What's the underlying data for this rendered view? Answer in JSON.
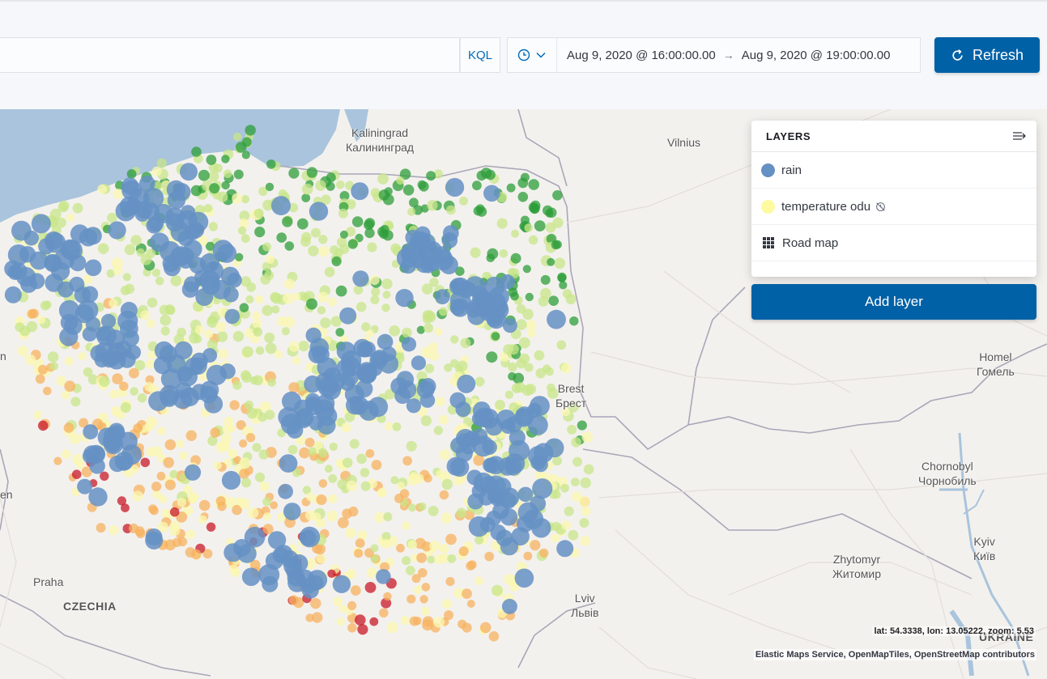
{
  "query_bar": {
    "language_toggle": "KQL",
    "date_start": "Aug 9, 2020 @ 16:00:00.00",
    "date_end": "Aug 9, 2020 @ 19:00:00.00",
    "refresh_label": "Refresh"
  },
  "map": {
    "places": [
      {
        "name": "Kaliningrad",
        "alt": "Калининград"
      },
      {
        "name": "Vilnius",
        "alt": ""
      },
      {
        "name": "Brest",
        "alt": "Брест"
      },
      {
        "name": "Homel",
        "alt": "Гомель"
      },
      {
        "name": "Chornobyl",
        "alt": "Чорнобиль"
      },
      {
        "name": "Zhytomyr",
        "alt": "Житомир"
      },
      {
        "name": "Kyiv",
        "alt": "Київ"
      },
      {
        "name": "Lviv",
        "alt": "Львів"
      },
      {
        "name": "Praha",
        "alt": ""
      }
    ],
    "countries": [
      "CZECHIA",
      "UKRAINE"
    ],
    "edge_fragments": [
      "n",
      "en"
    ],
    "colors": {
      "land": "#f3f1ee",
      "water": "#a9c4dc",
      "rain": "#6590c4",
      "temp_cool": "#2e9e3a",
      "temp_mild": "#c8e68a",
      "temp_neutral": "#fbf7b0",
      "temp_warm": "#f7b25f",
      "temp_hot": "#c8192a"
    }
  },
  "layers_panel": {
    "title": "LAYERS",
    "collapse_icon": "collapse-panel-icon",
    "layers": [
      {
        "name": "rain",
        "swatch": "#6590c4",
        "kind": "dot"
      },
      {
        "name": "temperature odu",
        "swatch": "#fdfaa0",
        "kind": "dot",
        "status_icon": "clock-slash-icon"
      },
      {
        "name": "Road map",
        "kind": "grid"
      }
    ],
    "add_layer_label": "Add layer"
  },
  "status": {
    "lat_label": "lat:",
    "lat": "54.3338,",
    "lon_label": "lon:",
    "lon": "13.05222,",
    "zoom_label": "zoom:",
    "zoom": "5.53"
  },
  "attribution": "Elastic Maps Service, OpenMapTiles, OpenStreetMap contributors"
}
